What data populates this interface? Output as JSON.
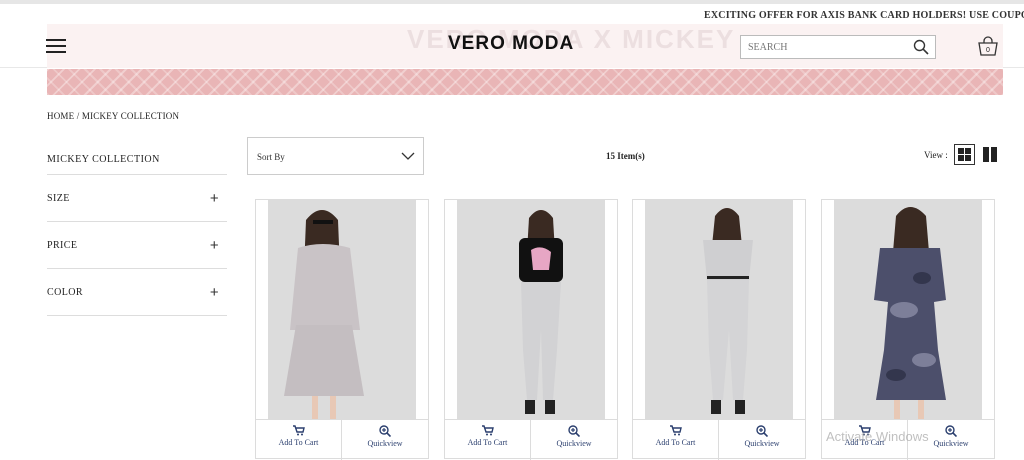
{
  "offer_text": "EXCITING OFFER FOR AXIS BANK CARD HOLDERS! USE COUPON C",
  "header": {
    "logo": "VERO MODA",
    "banner_ghost_text": "VERO MODA X MICKEY",
    "search_placeholder": "SEARCH",
    "cart_count": "0"
  },
  "breadcrumb": "HOME / MICKEY COLLECTION",
  "sidebar": {
    "title": "MICKEY COLLECTION",
    "filters": [
      {
        "label": "SIZE",
        "toggle": "+"
      },
      {
        "label": "PRICE",
        "toggle": "+"
      },
      {
        "label": "COLOR",
        "toggle": "+"
      }
    ]
  },
  "toolbar": {
    "sort_label": "Sort By",
    "item_count": "15 Item(s)",
    "view_label": "View :"
  },
  "products": [
    {
      "add_to_cart": "Add To Cart",
      "quickview": "Quickview",
      "garment_color": "#c9c3c6",
      "garment_type": "dress"
    },
    {
      "add_to_cart": "Add To Cart",
      "quickview": "Quickview",
      "garment_color": "#d2d2d4",
      "garment_type": "tee-pants"
    },
    {
      "add_to_cart": "Add To Cart",
      "quickview": "Quickview",
      "garment_color": "#cfcfd1",
      "garment_type": "top-pants"
    },
    {
      "add_to_cart": "Add To Cart",
      "quickview": "Quickview",
      "garment_color": "#4c4f6b",
      "garment_type": "camo-dress"
    }
  ],
  "os_watermark": "Activate Windows",
  "colors": {
    "banner_pink": "#e9b5b6",
    "link_blue": "#2b3f6e"
  }
}
